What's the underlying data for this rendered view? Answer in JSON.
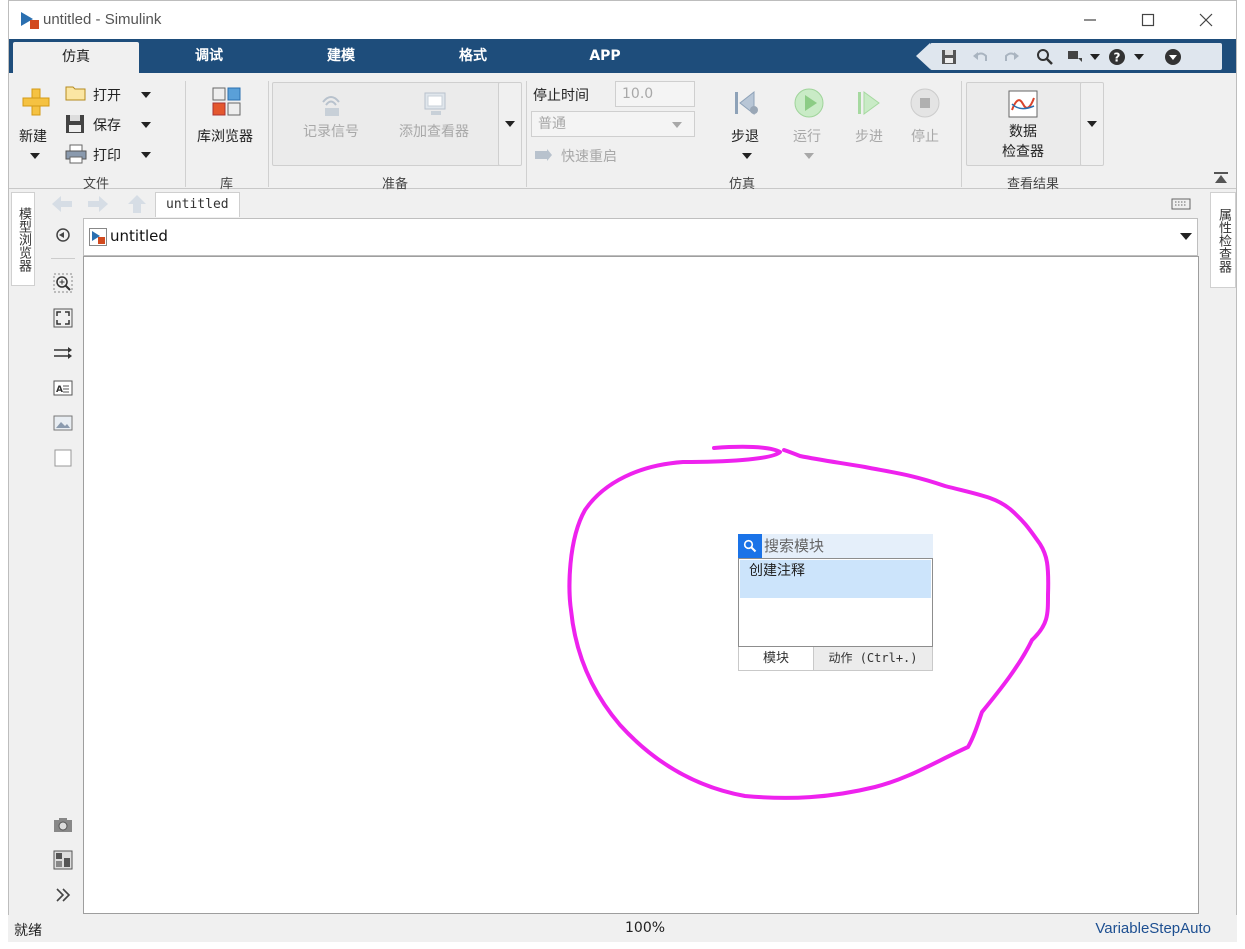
{
  "window": {
    "title": "untitled - Simulink"
  },
  "tabs": [
    {
      "label": "仿真",
      "active": true
    },
    {
      "label": "调试",
      "active": false
    },
    {
      "label": "建模",
      "active": false
    },
    {
      "label": "格式",
      "active": false
    },
    {
      "label": "APP",
      "active": false
    }
  ],
  "ribbon": {
    "file": {
      "new": "新建",
      "open": "打开",
      "save": "保存",
      "print": "打印",
      "group": "文件"
    },
    "library": {
      "browser": "库浏览器",
      "group": "库"
    },
    "prepare": {
      "log_signals": "记录信号",
      "add_viewer": "添加查看器",
      "stop_time_label": "停止时间",
      "stop_time_value": "10.0",
      "mode_value": "普通",
      "fast_restart": "快速重启",
      "group": "准备"
    },
    "simulation": {
      "step_back": "步退",
      "run": "运行",
      "step_forward": "步进",
      "stop": "停止",
      "group": "仿真"
    },
    "review": {
      "data_inspector_line1": "数据",
      "data_inspector_line2": "检查器",
      "group": "查看结果"
    }
  },
  "left_panel": {
    "model_browser": "模型浏览器"
  },
  "right_panel": {
    "property_inspector": "属性检查器"
  },
  "editor": {
    "breadcrumb_tab": "untitled",
    "address": "untitled"
  },
  "quick_insert": {
    "placeholder": "搜索模块",
    "result": "创建注释",
    "tab_blocks": "模块",
    "tab_actions": "动作 (Ctrl+.)"
  },
  "status": {
    "state": "就绪",
    "zoom": "100%",
    "solver": "VariableStepAuto"
  },
  "colors": {
    "tabbar": "#1e4d7b",
    "annotation": "#ee22ee",
    "selection": "#cce4fb",
    "search_icon_bg": "#1a73e8"
  }
}
